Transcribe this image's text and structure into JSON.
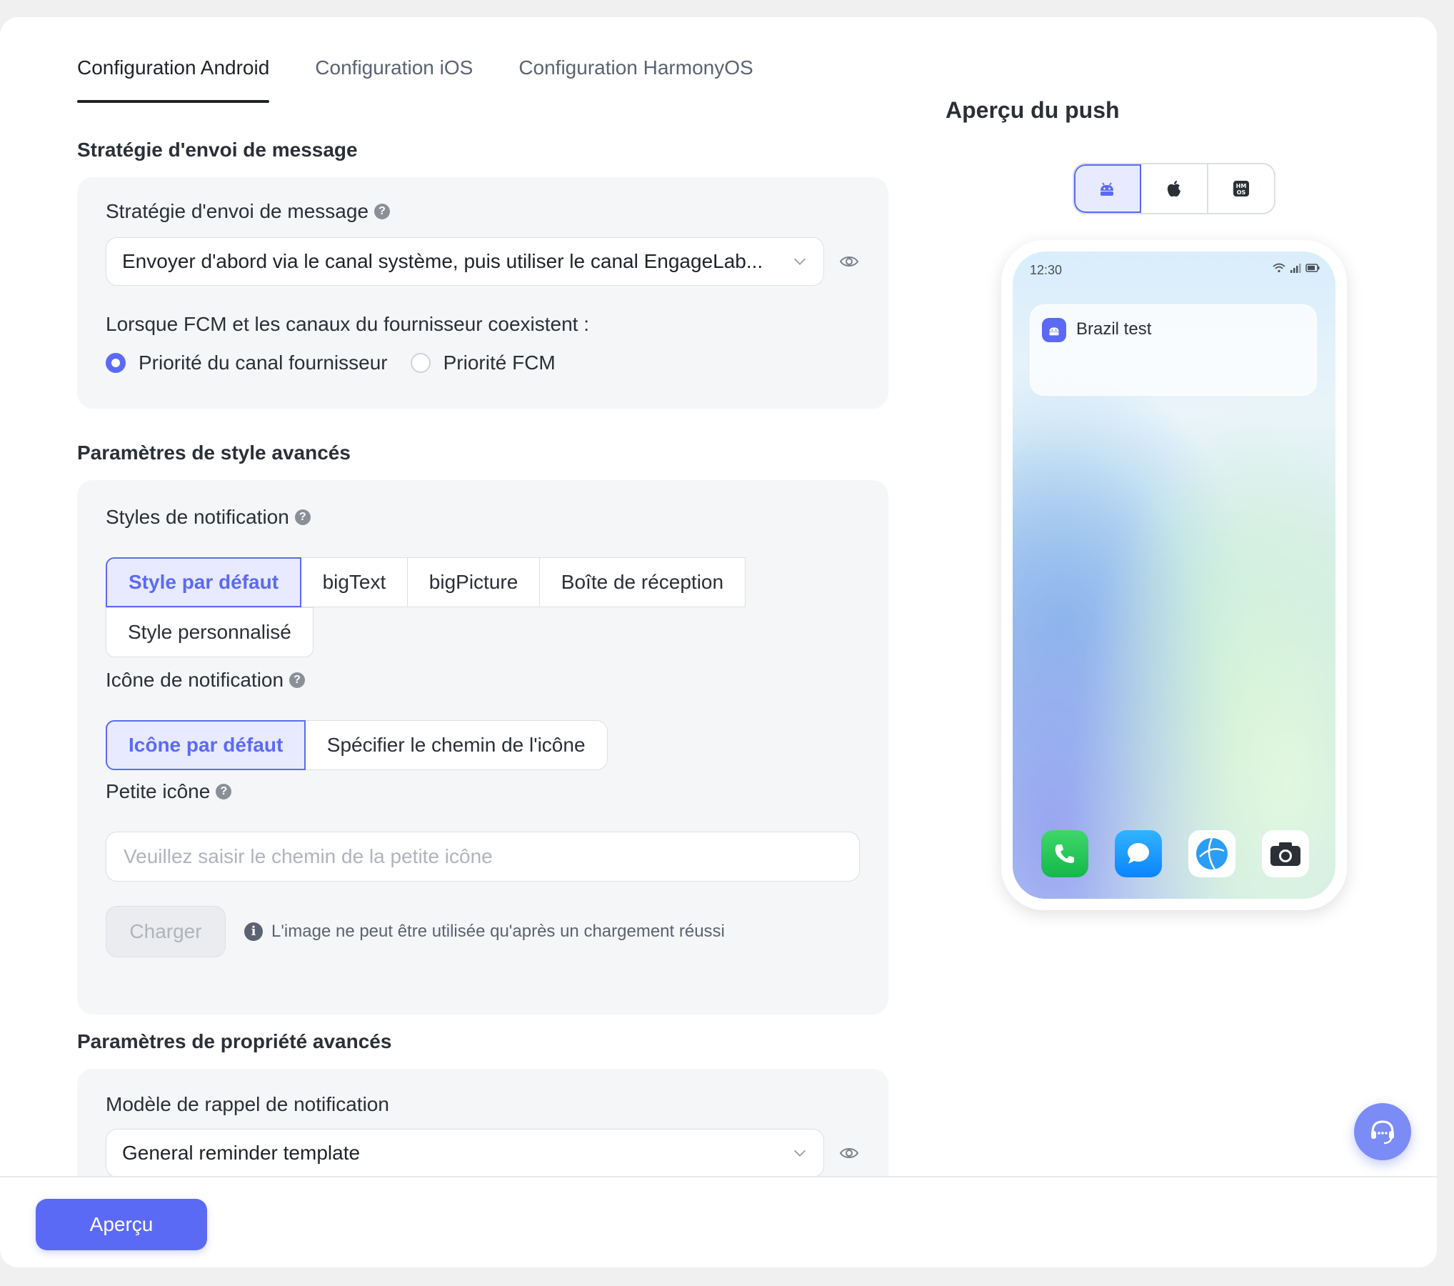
{
  "tabs": [
    {
      "label": "Configuration Android",
      "active": true
    },
    {
      "label": "Configuration iOS",
      "active": false
    },
    {
      "label": "Configuration HarmonyOS",
      "active": false
    }
  ],
  "strategy": {
    "section_title": "Stratégie d'envoi de message",
    "field_label": "Stratégie d'envoi de message",
    "select_value": "Envoyer d'abord via le canal système, puis utiliser le canal EngageLab...",
    "coexist_label": "Lorsque FCM et les canaux du fournisseur coexistent :",
    "radio_options": [
      {
        "label": "Priorité du canal fournisseur",
        "checked": true
      },
      {
        "label": "Priorité FCM",
        "checked": false
      }
    ]
  },
  "style": {
    "section_title": "Paramètres de style avancés",
    "notif_styles_label": "Styles de notification",
    "notif_styles": [
      {
        "label": "Style par défaut",
        "active": true
      },
      {
        "label": "bigText",
        "active": false
      },
      {
        "label": "bigPicture",
        "active": false
      },
      {
        "label": "Boîte de réception",
        "active": false
      },
      {
        "label": "Style personnalisé",
        "active": false
      }
    ],
    "notif_icon_label": "Icône de notification",
    "notif_icon_options": [
      {
        "label": "Icône par défaut",
        "active": true
      },
      {
        "label": "Spécifier le chemin de l'icône",
        "active": false
      }
    ],
    "small_icon_label": "Petite icône",
    "small_icon_placeholder": "Veuillez saisir le chemin de la petite icône",
    "upload_label": "Charger",
    "upload_hint": "L'image ne peut être utilisée qu'après un chargement réussi"
  },
  "property": {
    "section_title": "Paramètres de propriété avancés",
    "reminder_label": "Modèle de rappel de notification",
    "reminder_value": "General reminder template"
  },
  "footer": {
    "preview_button": "Aperçu"
  },
  "preview": {
    "title": "Aperçu du push",
    "os_buttons": [
      {
        "icon": "android-icon",
        "active": true
      },
      {
        "icon": "apple-icon",
        "active": false
      },
      {
        "icon": "harmonyos-icon",
        "active": false
      }
    ],
    "status_time": "12:30",
    "notification_title": "Brazil test",
    "dock_apps": [
      "phone-app-icon",
      "messages-app-icon",
      "browser-app-icon",
      "camera-app-icon"
    ]
  },
  "colors": {
    "accent": "#5b6af5",
    "accent_bg": "#e8ebff",
    "panel_bg": "#f5f6f8",
    "support_button": "#7b8cf7"
  }
}
